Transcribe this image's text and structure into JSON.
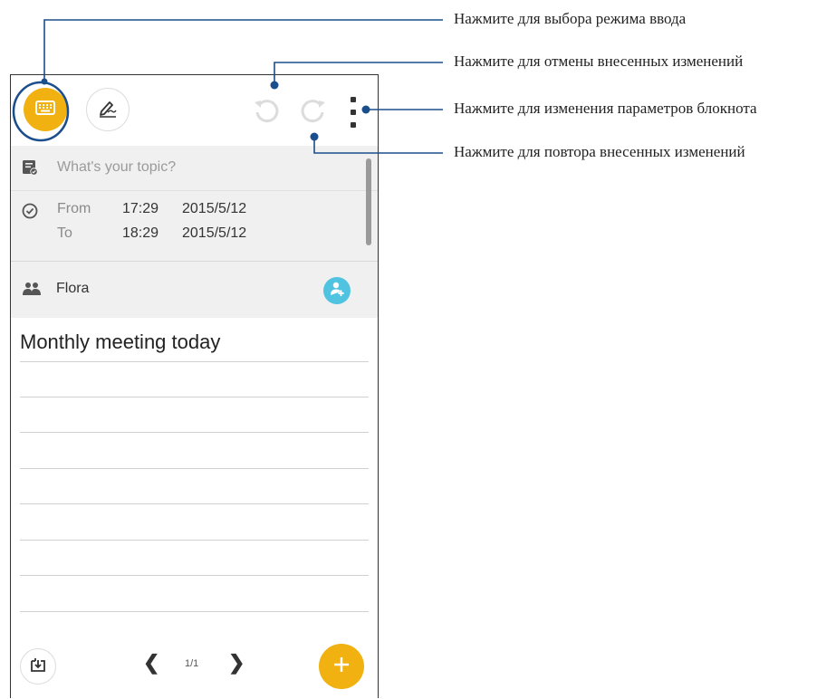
{
  "toolbar": {
    "keyboard_icon": "keyboard-icon",
    "pen_icon": "handwriting-pen-icon",
    "undo_icon": "undo-icon",
    "redo_icon": "redo-icon",
    "menu_icon": "more-vert-icon"
  },
  "topic": {
    "placeholder": "What's your topic?"
  },
  "time": {
    "from_label": "From",
    "from_time": "17:29",
    "from_date": "2015/5/12",
    "to_label": "To",
    "to_time": "18:29",
    "to_date": "2015/5/12"
  },
  "attendee": {
    "name": "Flora"
  },
  "notes": {
    "first_line": "Monthly meeting today"
  },
  "pager": {
    "prev": "❮",
    "current": "1/1",
    "next": "❯"
  },
  "callouts": {
    "input_mode": "Нажмите для выбора режима ввода",
    "undo": "Нажмите для отмены внесенных изменений",
    "settings": "Нажмите для изменения параметров блокнота",
    "redo": "Нажмите для повтора внесенных изменений"
  },
  "colors": {
    "accent": "#f0b111",
    "add_person": "#4fc3df",
    "callout_line": "#1b4e8c"
  }
}
